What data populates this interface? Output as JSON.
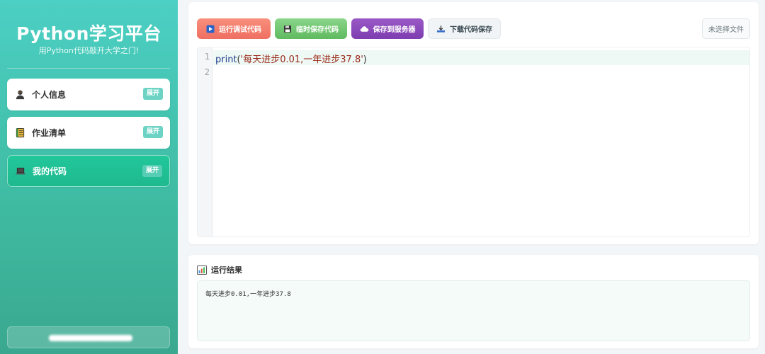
{
  "sidebar": {
    "title": "Python学习平台",
    "subtitle": "用Python代码敲开大学之门!",
    "items": [
      {
        "label": "个人信息",
        "icon": "person-icon",
        "action": "展开"
      },
      {
        "label": "作业清单",
        "icon": "notebook-icon",
        "action": "展开"
      },
      {
        "label": "我的代码",
        "icon": "laptop-icon",
        "action": "展开"
      }
    ]
  },
  "toolbar": {
    "run_label": "运行调试代码",
    "temp_save_label": "临时保存代码",
    "server_save_label": "保存到服务器",
    "download_label": "下载代码保存",
    "file_input_label": "未选择文件"
  },
  "editor": {
    "line_numbers": [
      "1",
      "2"
    ],
    "code_fn": "print",
    "code_open": "(",
    "code_string": "'每天进步0.01,一年进步37.8'",
    "code_close": ")"
  },
  "result": {
    "title": "运行结果",
    "output": "每天进步0.01,一年进步37.8"
  },
  "colors": {
    "sidebar_top": "#4ccfc4",
    "sidebar_bottom": "#3aa88f",
    "active_item": "#21c79a",
    "run_button": "#ef6f62",
    "temp_save_button": "#5fba5f",
    "server_button": "#7e3db0"
  }
}
